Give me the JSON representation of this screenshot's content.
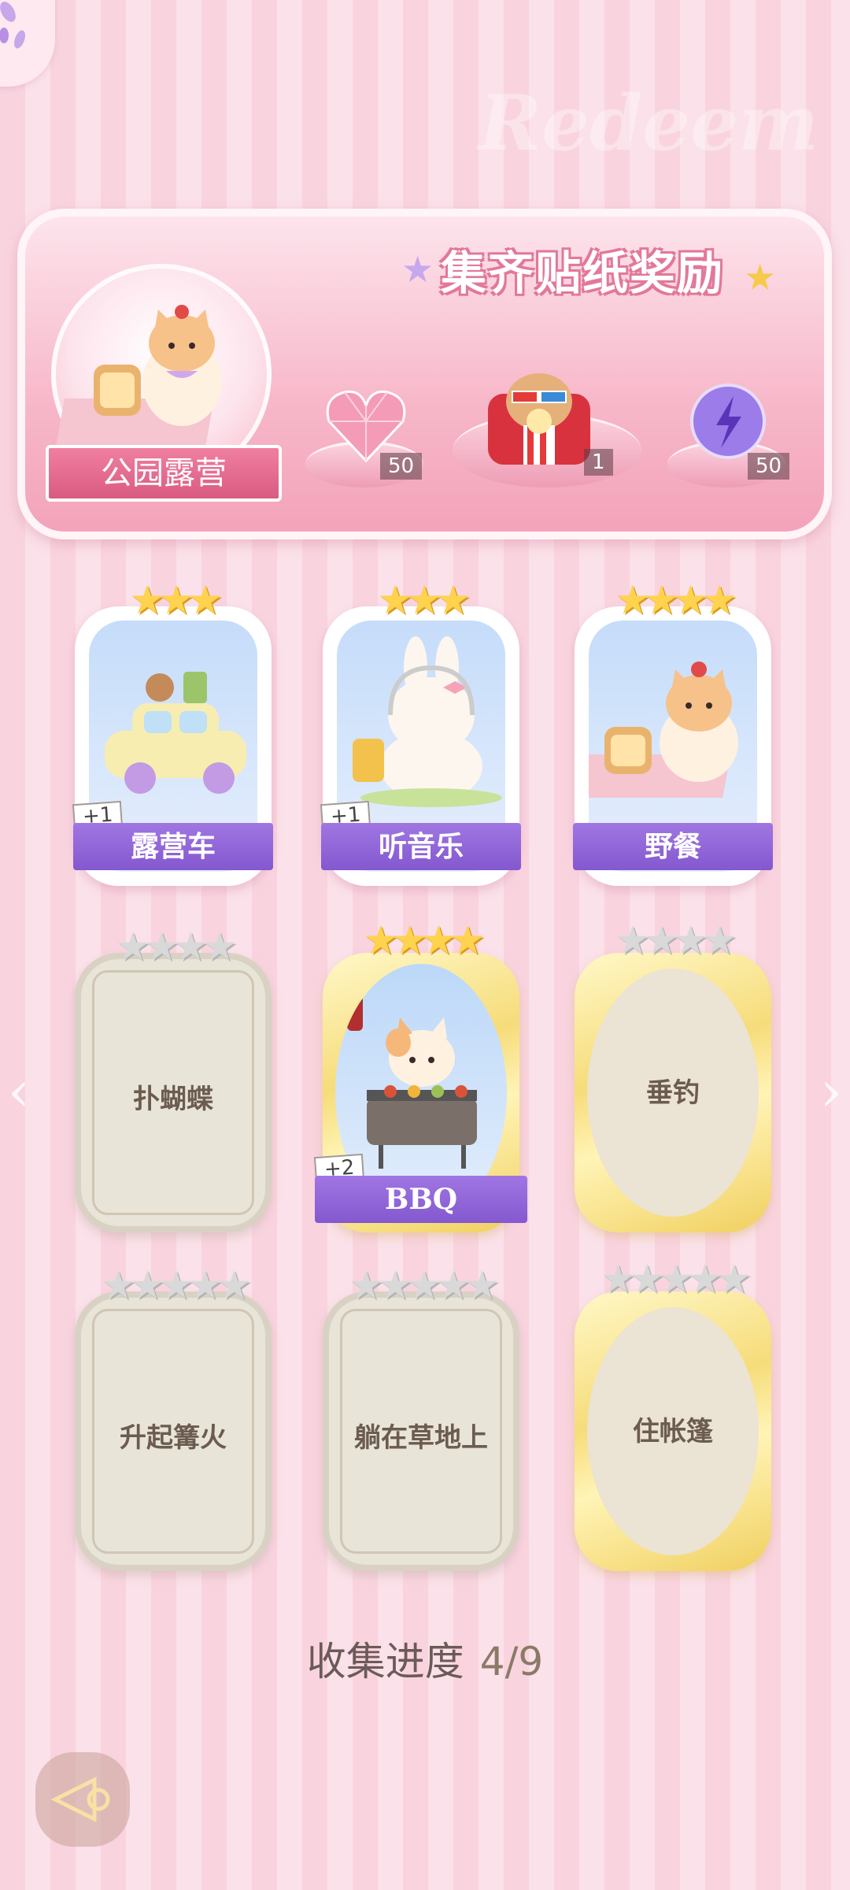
{
  "banner": {
    "title": "集齐贴纸奖励",
    "watermark": "Redeem",
    "map_name": "公园露营",
    "rewards": [
      {
        "icon": "pink-heart-gem-icon",
        "count": "50"
      },
      {
        "icon": "popcorn-cinema-cat-icon",
        "count": "1"
      },
      {
        "icon": "purple-lightning-orb-icon",
        "count": "50"
      }
    ]
  },
  "cards": [
    {
      "name": "露营车",
      "state": "unlocked",
      "stars": 3,
      "stars_total": 3,
      "bonus": "+1",
      "art": "camper-car-art"
    },
    {
      "name": "听音乐",
      "state": "unlocked",
      "stars": 3,
      "stars_total": 3,
      "bonus": "+1",
      "art": "bunny-music-art"
    },
    {
      "name": "野餐",
      "state": "unlocked",
      "stars": 4,
      "stars_total": 4,
      "bonus": "",
      "art": "cat-picnic-art"
    },
    {
      "name": "扑蝴蝶",
      "state": "locked",
      "stars": 0,
      "stars_total": 4
    },
    {
      "name": "BBQ",
      "state": "unlocked-gold",
      "stars": 4,
      "stars_total": 4,
      "bonus": "+2",
      "art": "cat-bbq-art"
    },
    {
      "name": "垂钓",
      "state": "locked-gold",
      "stars": 0,
      "stars_total": 4
    },
    {
      "name": "升起篝火",
      "state": "locked",
      "stars": 0,
      "stars_total": 5
    },
    {
      "name": "躺在草地上",
      "state": "locked",
      "stars": 0,
      "stars_total": 5
    },
    {
      "name": "住帐篷",
      "state": "locked-gold",
      "stars": 0,
      "stars_total": 5
    }
  ],
  "progress": {
    "label": "收集进度",
    "value": "4/9"
  },
  "colors": {
    "accent_purple": "#8e62d6",
    "star_gold": "#ffd34d",
    "banner_pink": "#f3a3ba"
  }
}
